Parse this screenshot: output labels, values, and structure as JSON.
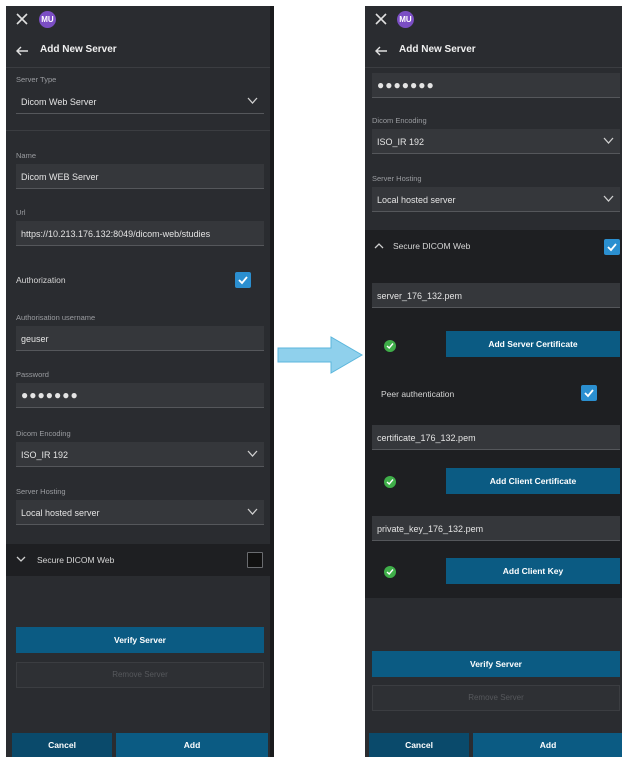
{
  "colors": {
    "panel": "#2a2c30",
    "field": "#35373b",
    "accent": "#0b5b83",
    "checkbox": "#2b8fd0",
    "success": "#3fae49",
    "avatar": "#7b4ec4",
    "arrow": "#8fd0ec"
  },
  "left": {
    "avatar": "MU",
    "title": "Add New Server",
    "server_type_label": "Server Type",
    "server_type_value": "Dicom Web Server",
    "name_label": "Name",
    "name_value": "Dicom WEB Server",
    "url_label": "Url",
    "url_value": "https://10.213.176.132:8049/dicom-web/studies",
    "authorization_label": "Authorization",
    "auth_username_label": "Authorisation username",
    "auth_username_value": "geuser",
    "password_label": "Password",
    "password_value": "●●●●●●●",
    "encoding_label": "Dicom Encoding",
    "encoding_value": "ISO_IR 192",
    "hosting_label": "Server Hosting",
    "hosting_value": "Local hosted server",
    "secure_label": "Secure DICOM Web",
    "verify_label": "Verify Server",
    "remove_label": "Remove Server",
    "cancel_label": "Cancel",
    "add_label": "Add"
  },
  "right": {
    "avatar": "MU",
    "title": "Add New Server",
    "password_value": "●●●●●●●",
    "encoding_label": "Dicom Encoding",
    "encoding_value": "ISO_IR 192",
    "hosting_label": "Server Hosting",
    "hosting_value": "Local hosted server",
    "secure_label": "Secure DICOM Web",
    "server_cert_file": "server_176_132.pem",
    "add_server_cert_label": "Add Server Certificate",
    "peer_auth_label": "Peer authentication",
    "client_cert_file": "certificate_176_132.pem",
    "add_client_cert_label": "Add Client Certificate",
    "client_key_file": "private_key_176_132.pem",
    "add_client_key_label": "Add Client Key",
    "verify_label": "Verify Server",
    "remove_label": "Remove Server",
    "cancel_label": "Cancel",
    "add_label": "Add"
  }
}
